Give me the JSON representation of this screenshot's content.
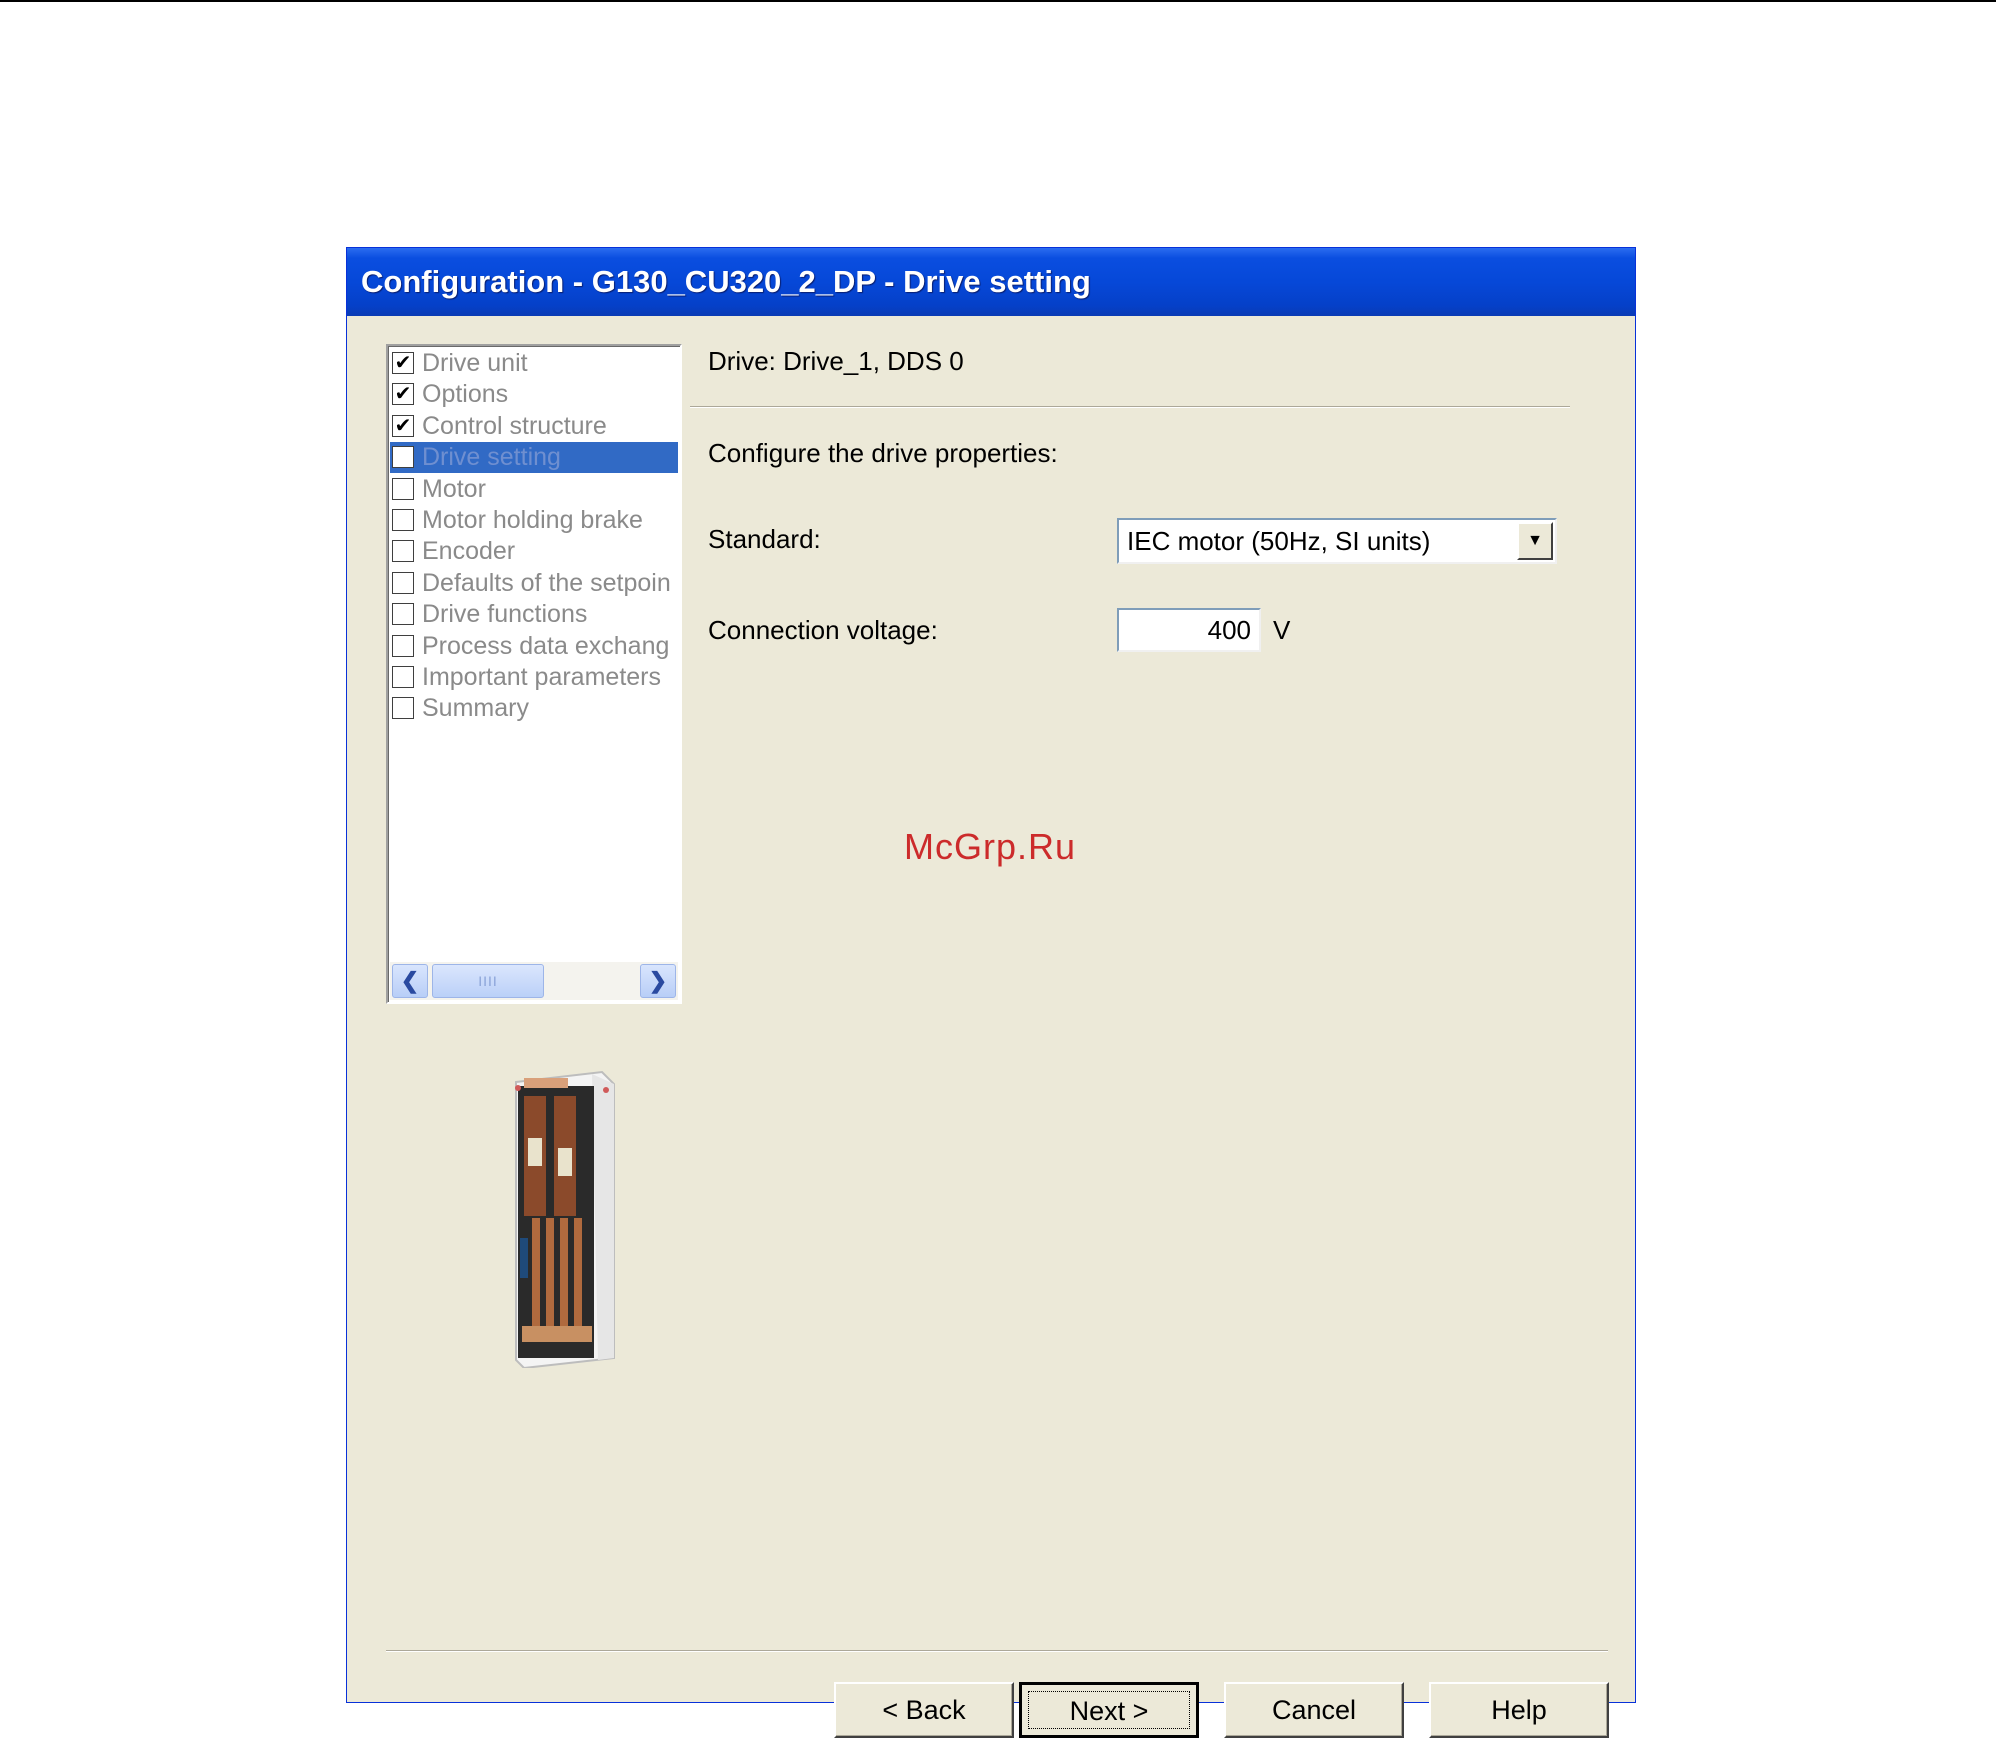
{
  "window": {
    "title": "Configuration - G130_CU320_2_DP - Drive setting"
  },
  "steps": [
    {
      "label": "Drive unit",
      "checked": true
    },
    {
      "label": "Options",
      "checked": true
    },
    {
      "label": "Control structure",
      "checked": true
    },
    {
      "label": "Drive setting",
      "checked": false,
      "selected": true
    },
    {
      "label": "Motor",
      "checked": false
    },
    {
      "label": "Motor holding brake",
      "checked": false
    },
    {
      "label": "Encoder",
      "checked": false
    },
    {
      "label": "Defaults of the setpoin",
      "checked": false
    },
    {
      "label": "Drive functions",
      "checked": false
    },
    {
      "label": "Process data exchang",
      "checked": false
    },
    {
      "label": "Important parameters",
      "checked": false
    },
    {
      "label": "Summary",
      "checked": false
    }
  ],
  "scrollbar": {
    "thumb_grip": "IIII"
  },
  "drive_info": "Drive: Drive_1, DDS 0",
  "instruction": "Configure the drive properties:",
  "standard": {
    "label": "Standard:",
    "value": "IEC motor (50Hz, SI units)"
  },
  "connection_voltage": {
    "label": "Connection voltage:",
    "value": "400",
    "unit": "V"
  },
  "watermark": "McGrp.Ru",
  "buttons": {
    "back": "< Back",
    "next": "Next >",
    "cancel": "Cancel",
    "help": "Help"
  },
  "icons": {
    "checkbox_checked": "check-icon",
    "scroll_left": "chevron-left-icon",
    "scroll_right": "chevron-right-icon",
    "dropdown": "chevron-down-icon"
  },
  "colors": {
    "title_bar": "#0648d8",
    "selection": "#316ac5",
    "dialog_bg": "#ece9d8",
    "watermark": "#cc2b2b"
  }
}
